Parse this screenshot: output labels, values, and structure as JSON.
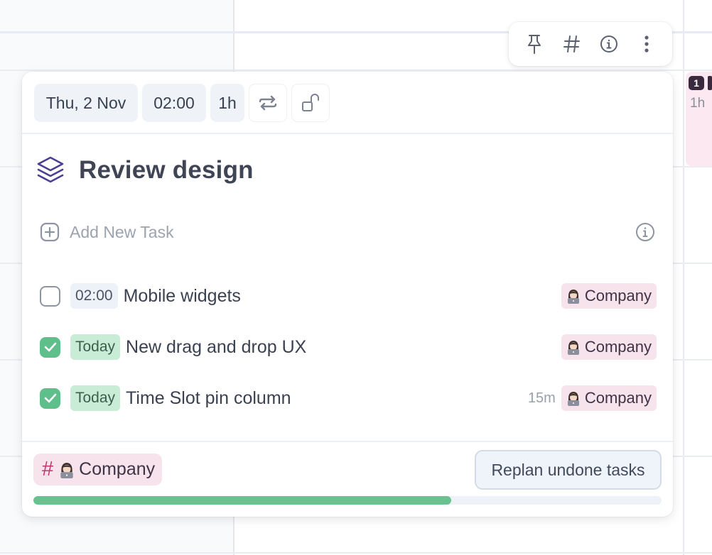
{
  "background": {
    "event": {
      "count": "1",
      "duration": "1h"
    }
  },
  "toolbar": {
    "buttons": [
      {
        "name": "pin",
        "icon": "pin-icon"
      },
      {
        "name": "tag",
        "icon": "hash-icon"
      },
      {
        "name": "info",
        "icon": "info-icon"
      },
      {
        "name": "more",
        "icon": "more-vertical-icon"
      }
    ]
  },
  "card": {
    "header": {
      "date": "Thu, 2 Nov",
      "time": "02:00",
      "duration": "1h",
      "repeat_icon": "repeat-icon",
      "lock_icon": "unlock-icon"
    },
    "title": "Review design",
    "title_icon": "layers-icon",
    "add_task": {
      "placeholder": "Add New Task",
      "icon": "plus-square-icon",
      "info_icon": "info-icon"
    },
    "tasks": [
      {
        "done": false,
        "when": "02:00",
        "when_type": "time",
        "name": "Mobile widgets",
        "estimate": "",
        "tag": "Company"
      },
      {
        "done": true,
        "when": "Today",
        "when_type": "today",
        "name": "New drag and drop UX",
        "estimate": "",
        "tag": "Company"
      },
      {
        "done": true,
        "when": "Today",
        "when_type": "today",
        "name": "Time Slot pin column",
        "estimate": "15m",
        "tag": "Company"
      }
    ],
    "footer": {
      "tag_hash": "#",
      "tag": "Company",
      "replan_label": "Replan undone tasks",
      "progress_percent": 66.5
    }
  },
  "colors": {
    "accent_green": "#68c28f",
    "tag_pink": "#f7e3ec",
    "hash_pink": "#c2376e",
    "title_icon_purple": "#4b3f8f"
  }
}
